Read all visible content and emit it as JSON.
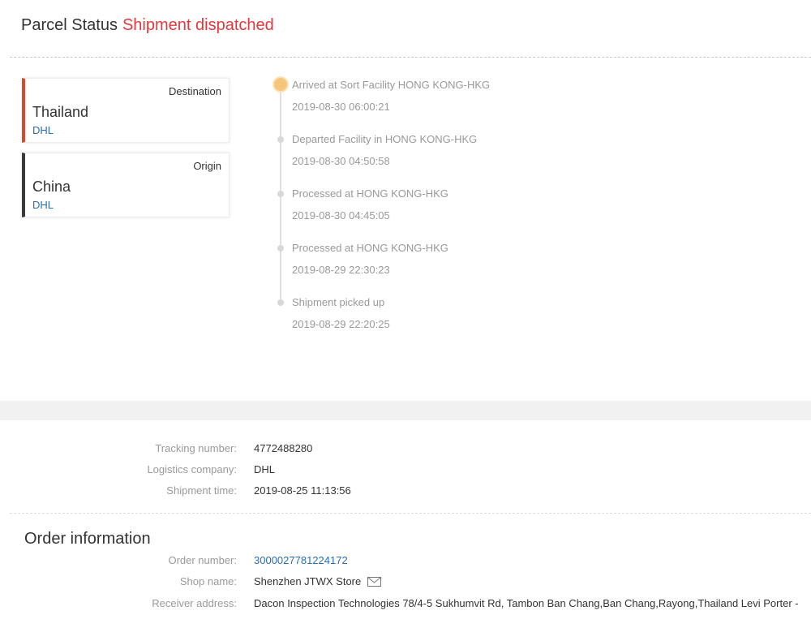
{
  "header": {
    "title": "Parcel Status",
    "status": "Shipment dispatched"
  },
  "destination": {
    "role": "Destination",
    "country": "Thailand",
    "carrier": "DHL"
  },
  "origin": {
    "role": "Origin",
    "country": "China",
    "carrier": "DHL"
  },
  "timeline": [
    {
      "event": "Arrived at Sort Facility HONG KONG-HKG",
      "time": "2019-08-30 06:00:21"
    },
    {
      "event": "Departed Facility in HONG KONG-HKG",
      "time": "2019-08-30 04:50:58"
    },
    {
      "event": "Processed at HONG KONG-HKG",
      "time": "2019-08-30 04:45:05"
    },
    {
      "event": "Processed at HONG KONG-HKG",
      "time": "2019-08-29 22:30:23"
    },
    {
      "event": "Shipment picked up",
      "time": "2019-08-29 22:20:25"
    }
  ],
  "shipping": {
    "tracking_label": "Tracking number:",
    "tracking_value": "4772488280",
    "company_label": "Logistics company:",
    "company_value": "DHL",
    "time_label": "Shipment time:",
    "time_value": "2019-08-25 11:13:56"
  },
  "order": {
    "title": "Order information",
    "number_label": "Order number:",
    "number_value": "3000027781224172",
    "shop_label": "Shop name:",
    "shop_value": "Shenzhen JTWX Store",
    "address_label": "Receiver address:",
    "address_value": "Dacon Inspection Technologies 78/4-5 Sukhumvit Rd, Tambon Ban Chang,Ban Chang,Rayong,Thailand Levi Porter -"
  },
  "colors": {
    "status": "#e4393c",
    "link": "#2a6db5",
    "destination_bar": "#d64a2f",
    "origin_bar": "#3a3a3a",
    "first_dot": "#f6c77a"
  },
  "icons": {
    "shop_contact": "mail-icon"
  }
}
